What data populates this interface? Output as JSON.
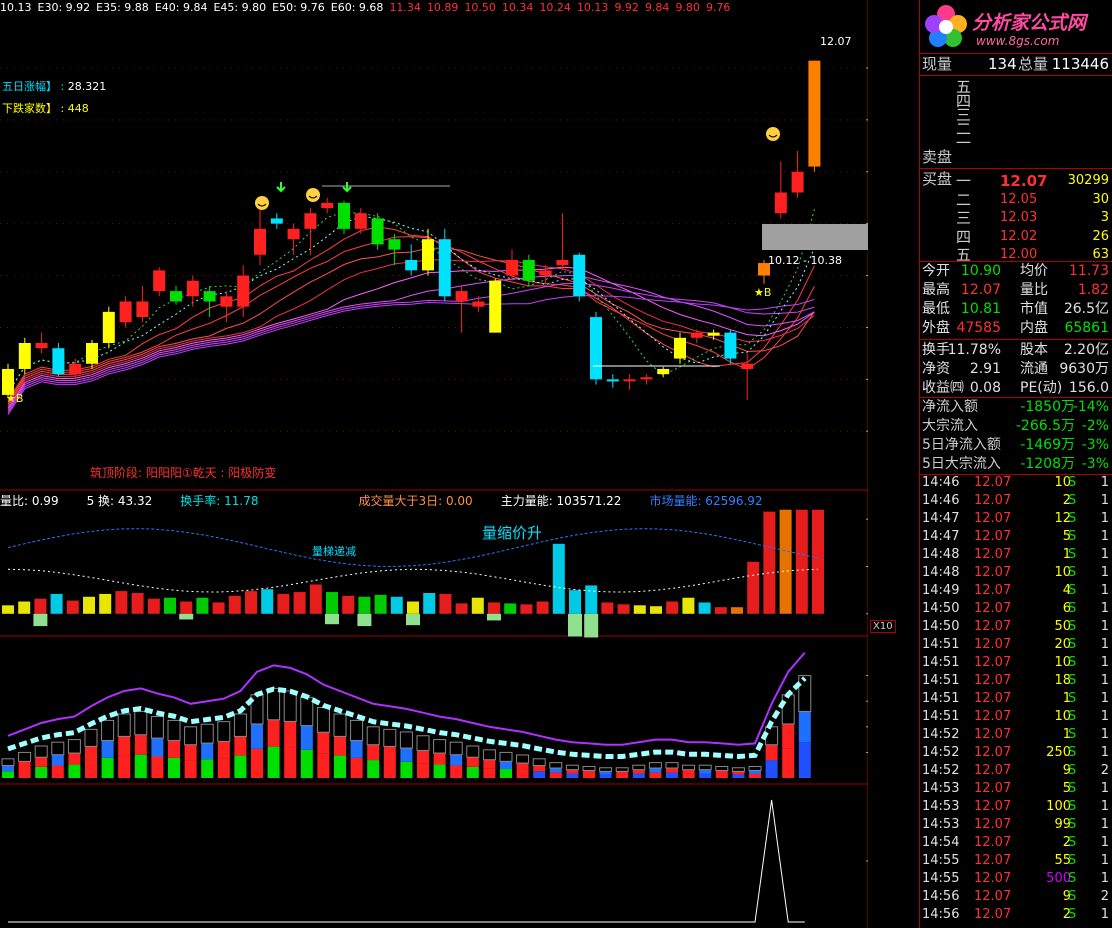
{
  "topbar": [
    {
      "t": "10.13",
      "c": "#ffffff"
    },
    {
      "t": "E30: 9.92",
      "c": "#ffffff"
    },
    {
      "t": "E35: 9.88",
      "c": "#ffffff"
    },
    {
      "t": "E40: 9.84",
      "c": "#ffffff"
    },
    {
      "t": "E45: 9.80",
      "c": "#ffffff"
    },
    {
      "t": "E50: 9.76",
      "c": "#ffffff"
    },
    {
      "t": "E60: 9.68",
      "c": "#ffffff"
    },
    {
      "t": "11.34",
      "c": "#ff3030"
    },
    {
      "t": "10.89",
      "c": "#ff3030"
    },
    {
      "t": "10.50",
      "c": "#ff3030"
    },
    {
      "t": "10.34",
      "c": "#ff3030"
    },
    {
      "t": "10.24",
      "c": "#ff3030"
    },
    {
      "t": "10.13",
      "c": "#ff3030"
    },
    {
      "t": "9.92",
      "c": "#ff3030"
    },
    {
      "t": "9.84",
      "c": "#ff3030"
    },
    {
      "t": "9.80",
      "c": "#ff3030"
    },
    {
      "t": "9.76",
      "c": "#ff3030"
    }
  ],
  "annotations": {
    "five_day_label": "五日涨幅】",
    "five_day_value": "28.321",
    "down_label": "下跌家数】",
    "down_value": "448",
    "phase_text": "筑顶阶段: 阳阳阳①乾天 : 阳极防变",
    "high_label": "12.07",
    "range_label": "10.12 - 10.38",
    "b1": "★B",
    "b2": "★B",
    "vol_row": [
      {
        "t": "量比: 0.99",
        "c": "#ffffff"
      },
      {
        "t": "5 换: 43.32",
        "c": "#ffffff"
      },
      {
        "t": "换手率: 11.78",
        "c": "#00e0e0"
      },
      {
        "t": "成交量大于3日: 0.00",
        "c": "#ff9040"
      },
      {
        "t": "主力量能: 103571.22",
        "c": "#ffffff"
      },
      {
        "t": "市场量能: 62596.92",
        "c": "#3080ff"
      }
    ],
    "vol_text1": "量缩价升",
    "vol_text2": "量梯递减",
    "x10": "X10"
  },
  "chart_data": [
    {
      "type": "candlestick",
      "title": "",
      "ylim": [
        8.3,
        12.25
      ],
      "yticks": [
        "12.0",
        "11.50",
        "11.00",
        "10.50",
        "10.00",
        "9.50",
        "9.00",
        "8.50"
      ],
      "candles": [
        [
          9.1,
          8.85,
          9.15,
          8.82,
          "y"
        ],
        [
          9.1,
          9.35,
          9.4,
          9.05,
          "y"
        ],
        [
          9.35,
          9.3,
          9.45,
          9.25,
          "r"
        ],
        [
          9.3,
          9.05,
          9.35,
          9.03,
          "c"
        ],
        [
          9.05,
          9.15,
          9.2,
          9.0,
          "r"
        ],
        [
          9.15,
          9.35,
          9.38,
          9.1,
          "y"
        ],
        [
          9.35,
          9.65,
          9.7,
          9.3,
          "y"
        ],
        [
          9.75,
          9.55,
          9.8,
          9.5,
          "r"
        ],
        [
          9.6,
          9.75,
          9.9,
          9.55,
          "r"
        ],
        [
          9.85,
          10.05,
          10.08,
          9.8,
          "r"
        ],
        [
          9.85,
          9.75,
          9.9,
          9.72,
          "g"
        ],
        [
          9.8,
          9.95,
          10.0,
          9.7,
          "r"
        ],
        [
          9.75,
          9.85,
          9.9,
          9.6,
          "g"
        ],
        [
          9.7,
          9.8,
          9.85,
          9.55,
          "r"
        ],
        [
          9.7,
          10.0,
          10.1,
          9.6,
          "r"
        ],
        [
          10.2,
          10.45,
          10.65,
          10.1,
          "r"
        ],
        [
          10.55,
          10.5,
          10.6,
          10.45,
          "c"
        ],
        [
          10.35,
          10.45,
          10.5,
          10.2,
          "r"
        ],
        [
          10.45,
          10.6,
          10.65,
          10.2,
          "r"
        ],
        [
          10.65,
          10.7,
          10.75,
          10.6,
          "r"
        ],
        [
          10.45,
          10.7,
          10.72,
          10.4,
          "g"
        ],
        [
          10.6,
          10.45,
          10.65,
          10.4,
          "r"
        ],
        [
          10.55,
          10.3,
          10.6,
          10.25,
          "g"
        ],
        [
          10.35,
          10.25,
          10.4,
          10.1,
          "g"
        ],
        [
          10.15,
          10.05,
          10.3,
          10.0,
          "c"
        ],
        [
          10.05,
          10.35,
          10.45,
          10.0,
          "y"
        ],
        [
          10.35,
          9.8,
          10.45,
          9.75,
          "c"
        ],
        [
          9.85,
          9.75,
          9.9,
          9.45,
          "r"
        ],
        [
          9.7,
          9.75,
          9.8,
          9.65,
          "r"
        ],
        [
          9.45,
          9.95,
          9.97,
          9.45,
          "y"
        ],
        [
          10.15,
          10.0,
          10.25,
          9.95,
          "r"
        ],
        [
          10.15,
          9.95,
          10.2,
          9.9,
          "g"
        ],
        [
          10.0,
          10.05,
          10.1,
          9.92,
          "r"
        ],
        [
          10.1,
          10.15,
          10.6,
          10.05,
          "r"
        ],
        [
          10.2,
          9.8,
          10.22,
          9.75,
          "c"
        ],
        [
          9.6,
          9.0,
          9.65,
          8.95,
          "c"
        ],
        [
          9.0,
          8.98,
          9.05,
          8.92,
          "c"
        ],
        [
          8.99,
          9.0,
          9.05,
          8.9,
          "r"
        ],
        [
          9.0,
          9.02,
          9.05,
          8.95,
          "r"
        ],
        [
          9.05,
          9.1,
          9.12,
          9.02,
          "y"
        ],
        [
          9.2,
          9.4,
          9.45,
          9.15,
          "y"
        ],
        [
          9.4,
          9.45,
          9.48,
          9.35,
          "r"
        ],
        [
          9.45,
          9.42,
          9.48,
          9.38,
          "y"
        ],
        [
          9.45,
          9.2,
          9.48,
          9.15,
          "c"
        ],
        [
          9.15,
          9.1,
          9.25,
          8.8,
          "r"
        ],
        [
          10.0,
          10.12,
          10.15,
          9.92,
          "o"
        ],
        [
          10.6,
          10.8,
          11.1,
          10.55,
          "r"
        ],
        [
          10.8,
          11.0,
          11.2,
          10.75,
          "r"
        ],
        [
          11.05,
          12.07,
          12.07,
          11.0,
          "o"
        ]
      ]
    },
    {
      "type": "bar",
      "title": "",
      "ylim": [
        -1500,
        11500
      ],
      "yticks": [
        "10000",
        "5000",
        "0"
      ],
      "series": [
        {
          "values": [
            900,
            1300,
            1600,
            2100,
            1400,
            1800,
            2100,
            2400,
            2200,
            1600,
            1700,
            1300,
            1700,
            1200,
            1900,
            2400,
            2600,
            2100,
            2300,
            3100,
            2300,
            1900,
            1800,
            2000,
            1800,
            1300,
            2200,
            2100,
            1100,
            1700,
            1200,
            1100,
            1000,
            1300,
            7400,
            2500,
            3000,
            1200,
            1000,
            900,
            800,
            1300,
            1700,
            1200,
            700,
            700,
            5500,
            10800,
            11000,
            11000,
            11000
          ]
        },
        {
          "values": [
            0,
            0,
            -1300,
            0,
            0,
            0,
            0,
            0,
            0,
            0,
            0,
            -600,
            0,
            0,
            0,
            0,
            0,
            0,
            0,
            0,
            -1100,
            0,
            -1300,
            0,
            0,
            -1200,
            0,
            0,
            0,
            0,
            -700,
            0,
            0,
            0,
            0,
            -2400,
            -2500,
            0,
            0,
            0,
            0,
            0,
            0,
            0,
            0,
            0,
            0,
            0,
            0,
            0,
            0
          ]
        }
      ]
    },
    {
      "type": "bar",
      "title": "",
      "ylim": [
        0,
        100
      ],
      "yticks": [
        "80.00",
        "60.00",
        "40.00",
        "20.00"
      ],
      "categories_count": 49,
      "values": [
        15,
        20,
        25,
        28,
        30,
        38,
        45,
        50,
        52,
        48,
        45,
        40,
        42,
        44,
        50,
        65,
        70,
        68,
        63,
        55,
        50,
        45,
        40,
        38,
        36,
        33,
        30,
        28,
        25,
        22,
        20,
        18,
        15,
        12,
        10,
        9,
        8,
        8,
        10,
        12,
        12,
        10,
        10,
        9,
        8,
        9,
        40,
        65,
        80
      ]
    },
    {
      "type": "line",
      "title": "",
      "ylim": [
        0,
        1
      ],
      "yticks": [
        "0.50"
      ],
      "values": [
        0,
        0,
        0,
        0,
        0,
        0,
        0,
        0,
        0,
        0,
        0,
        0,
        0,
        0,
        0,
        0,
        0,
        0,
        0,
        0,
        0,
        0,
        0,
        0,
        0,
        0,
        0,
        0,
        0,
        0,
        0,
        0,
        0,
        0,
        0,
        0,
        0,
        0,
        0,
        0,
        0,
        0,
        0,
        0,
        0,
        0,
        1,
        0,
        0
      ]
    }
  ],
  "side": {
    "logo_title": "分析家公式网",
    "logo_url": "www.8gs.com",
    "xianliang_label": "现量",
    "xianliang": "134",
    "zongliang_label": "总量",
    "zongliang": "113446",
    "sell_levels": [
      "五",
      "四",
      "三",
      "二",
      "一"
    ],
    "sell_label": "卖盘",
    "buy_label": "买盘",
    "buy": [
      {
        "l": "一",
        "p": "12.07",
        "v": "30299"
      },
      {
        "l": "二",
        "p": "12.05",
        "v": "30"
      },
      {
        "l": "三",
        "p": "12.03",
        "v": "3"
      },
      {
        "l": "四",
        "p": "12.02",
        "v": "26"
      },
      {
        "l": "五",
        "p": "12.00",
        "v": "63"
      }
    ],
    "stats": [
      [
        {
          "t": "今开",
          "c": "#e0e0e0"
        },
        {
          "t": "10.90",
          "c": "#00e000"
        },
        {
          "t": "均价",
          "c": "#e0e0e0"
        },
        {
          "t": "11.73",
          "c": "#ff3030"
        }
      ],
      [
        {
          "t": "最高",
          "c": "#e0e0e0"
        },
        {
          "t": "12.07",
          "c": "#ff3030"
        },
        {
          "t": "量比",
          "c": "#e0e0e0"
        },
        {
          "t": "1.82",
          "c": "#ff3030"
        }
      ],
      [
        {
          "t": "最低",
          "c": "#e0e0e0"
        },
        {
          "t": "10.81",
          "c": "#00e000"
        },
        {
          "t": "市值",
          "c": "#e0e0e0"
        },
        {
          "t": "26.5亿",
          "c": "#e0e0e0"
        }
      ],
      [
        {
          "t": "外盘",
          "c": "#e0e0e0"
        },
        {
          "t": "47585",
          "c": "#ff3030"
        },
        {
          "t": "内盘",
          "c": "#e0e0e0"
        },
        {
          "t": "65861",
          "c": "#00e000"
        }
      ]
    ],
    "stats2": [
      [
        {
          "t": "换手",
          "c": "#e0e0e0"
        },
        {
          "t": "11.78%",
          "c": "#e0e0e0"
        },
        {
          "t": "股本",
          "c": "#e0e0e0"
        },
        {
          "t": "2.20亿",
          "c": "#e0e0e0"
        }
      ],
      [
        {
          "t": "净资",
          "c": "#e0e0e0"
        },
        {
          "t": "2.91",
          "c": "#e0e0e0"
        },
        {
          "t": "流通",
          "c": "#e0e0e0"
        },
        {
          "t": "9630万",
          "c": "#e0e0e0"
        }
      ],
      [
        {
          "t": "收益㈣",
          "c": "#e0e0e0"
        },
        {
          "t": "0.08",
          "c": "#e0e0e0"
        },
        {
          "t": "PE(动)",
          "c": "#e0e0e0"
        },
        {
          "t": "156.0",
          "c": "#e0e0e0"
        }
      ]
    ],
    "flows": [
      {
        "l": "净流入额",
        "v": "-1850万",
        "p": "-14%"
      },
      {
        "l": "大宗流入",
        "v": "-266.5万",
        "p": "-2%"
      },
      {
        "l": "5日净流入额",
        "v": "-1469万",
        "p": "-3%"
      },
      {
        "l": "5日大宗流入",
        "v": "-1208万",
        "p": "-3%"
      }
    ],
    "ticks": [
      [
        "14:46",
        "12.07",
        "10",
        "S",
        "1"
      ],
      [
        "14:46",
        "12.07",
        "2",
        "S",
        "1"
      ],
      [
        "14:47",
        "12.07",
        "12",
        "S",
        "1"
      ],
      [
        "14:47",
        "12.07",
        "5",
        "S",
        "1"
      ],
      [
        "14:48",
        "12.07",
        "1",
        "S",
        "1"
      ],
      [
        "14:48",
        "12.07",
        "10",
        "S",
        "1"
      ],
      [
        "14:49",
        "12.07",
        "4",
        "S",
        "1"
      ],
      [
        "14:50",
        "12.07",
        "6",
        "S",
        "1"
      ],
      [
        "14:50",
        "12.07",
        "50",
        "S",
        "1"
      ],
      [
        "14:51",
        "12.07",
        "20",
        "S",
        "1"
      ],
      [
        "14:51",
        "12.07",
        "10",
        "S",
        "1"
      ],
      [
        "14:51",
        "12.07",
        "18",
        "S",
        "1"
      ],
      [
        "14:51",
        "12.07",
        "1",
        "S",
        "1"
      ],
      [
        "14:51",
        "12.07",
        "10",
        "S",
        "1"
      ],
      [
        "14:52",
        "12.07",
        "1",
        "S",
        "1"
      ],
      [
        "14:52",
        "12.07",
        "250",
        "S",
        "1"
      ],
      [
        "14:52",
        "12.07",
        "9",
        "S",
        "2"
      ],
      [
        "14:53",
        "12.07",
        "5",
        "S",
        "1"
      ],
      [
        "14:53",
        "12.07",
        "100",
        "S",
        "1"
      ],
      [
        "14:53",
        "12.07",
        "99",
        "S",
        "1"
      ],
      [
        "14:54",
        "12.07",
        "2",
        "S",
        "1"
      ],
      [
        "14:55",
        "12.07",
        "55",
        "S",
        "1"
      ],
      [
        "14:55",
        "12.07",
        "500",
        "S",
        "1"
      ],
      [
        "14:56",
        "12.07",
        "9",
        "S",
        "2"
      ],
      [
        "14:56",
        "12.07",
        "2",
        "S",
        "1"
      ]
    ]
  },
  "colors": {
    "up": "#ff2020",
    "down": "#00e0ff",
    "yellow": "#ffff00",
    "orange": "#ff8000",
    "green": "#00e000",
    "frame": "#a00000"
  }
}
